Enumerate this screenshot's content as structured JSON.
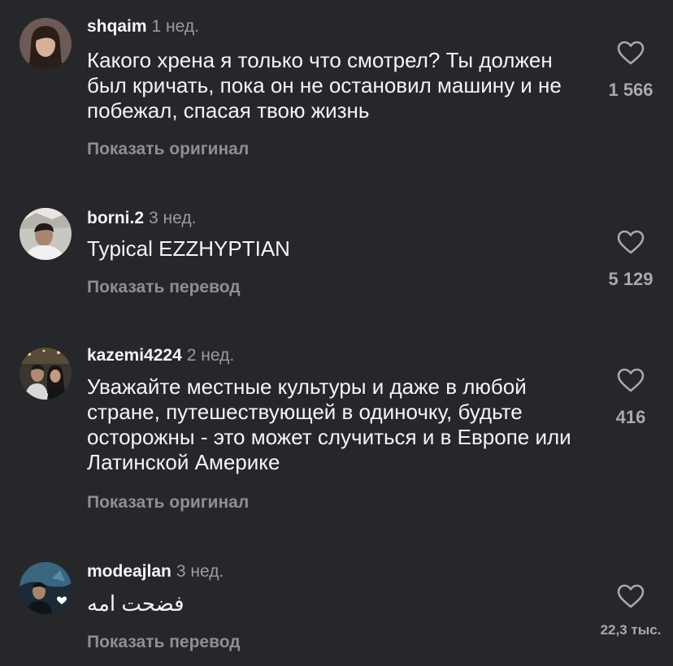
{
  "comments": [
    {
      "username": "shqaim",
      "time": "1 нед.",
      "text": "Какого хрена я только что смотрел? Ты должен был кричать, пока он не остановил машину и не побежал, спасая твою жизнь",
      "action": "Показать оригинал",
      "likes": "1 566",
      "avatar_icon": "avatar-woman-dark-hair"
    },
    {
      "username": "borni.2",
      "time": "3 нед.",
      "text": "Typical EZZHYPTIAN",
      "action": "Показать перевод",
      "likes": "5 129",
      "avatar_icon": "avatar-man-outdoors"
    },
    {
      "username": "kazemi4224",
      "time": "2 нед.",
      "text": "Уважайте местные культуры и даже в любой стране, путешествующей в одиночку, будьте осторожны - это может случиться и в Европе или Латинской Америке",
      "action": "Показать оригинал",
      "likes": "416",
      "avatar_icon": "avatar-couple-night"
    },
    {
      "username": "modeajlan",
      "time": "3 нед.",
      "text": "فضحت امه",
      "action": "Показать перевод",
      "likes": "22,3 тыс.",
      "avatar_icon": "avatar-person-aquarium"
    }
  ],
  "colors": {
    "background": "#26272b",
    "primary_text": "#f4f4f4",
    "secondary_text": "#9a9b9f",
    "action_text": "#8e8f93"
  }
}
